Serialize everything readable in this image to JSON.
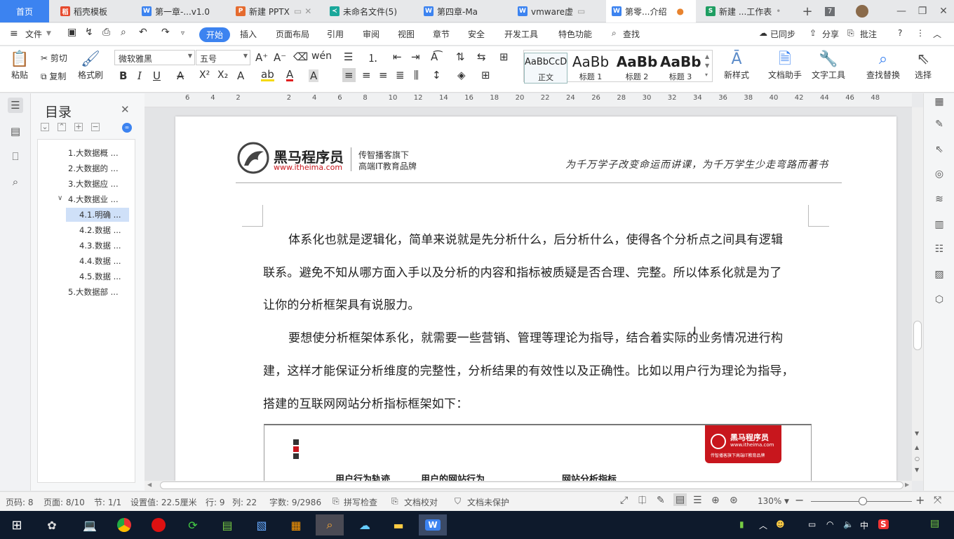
{
  "tabs": [
    {
      "label": "首页"
    },
    {
      "label": "稻壳模板",
      "icon": "docer-icon",
      "color": "#e64a2e"
    },
    {
      "label": "第一章-...v1.0",
      "icon": "word-doc-icon",
      "color": "#3c83f0"
    },
    {
      "label": "新建 PPTX",
      "icon": "ppt-icon",
      "color": "#e56b2f"
    },
    {
      "label": "未命名文件(5)",
      "icon": "flowchart-icon",
      "color": "#19a79a"
    },
    {
      "label": "第四章-Ma",
      "icon": "word-doc-icon",
      "color": "#3c83f0"
    },
    {
      "label": "vmware虚",
      "icon": "word-doc-icon",
      "color": "#3c83f0"
    },
    {
      "label": "第零...介绍",
      "icon": "word-doc-icon",
      "color": "#3c83f0"
    },
    {
      "label": "新建 ...工作表",
      "icon": "sheet-icon",
      "color": "#1e9e62"
    }
  ],
  "tab_count": "7",
  "menu": {
    "file": "文件",
    "items": [
      "开始",
      "插入",
      "页面布局",
      "引用",
      "审阅",
      "视图",
      "章节",
      "安全",
      "开发工具",
      "特色功能"
    ],
    "search": "查找",
    "sync": "已同步",
    "share": "分享",
    "comment": "批注"
  },
  "ribbon": {
    "paste": "粘贴",
    "cut": "剪切",
    "copy": "复制",
    "format_painter": "格式刷",
    "font": "微软雅黑",
    "size": "五号",
    "styles": [
      {
        "preview": "AaBbCcD",
        "label": "正文"
      },
      {
        "preview": "AaBb",
        "label": "标题 1"
      },
      {
        "preview": "AaBb",
        "label": "标题 2"
      },
      {
        "preview": "AaBb",
        "label": "标题 3"
      }
    ],
    "new_style": "新样式",
    "doc_assistant": "文档助手",
    "text_tools": "文字工具",
    "find_replace": "查找替换",
    "select": "选择"
  },
  "toc": {
    "title": "目录",
    "items": [
      {
        "label": "1.大数据概 ...",
        "level": 1
      },
      {
        "label": "2.大数据的 ...",
        "level": 1
      },
      {
        "label": "3.大数据应 ...",
        "level": 1
      },
      {
        "label": "4.大数据业 ...",
        "level": 1
      },
      {
        "label": "4.1.明确 ...",
        "level": 2
      },
      {
        "label": "4.2.数据 ...",
        "level": 2
      },
      {
        "label": "4.3.数据 ...",
        "level": 2
      },
      {
        "label": "4.4.数据 ...",
        "level": 2
      },
      {
        "label": "4.5.数据 ...",
        "level": 2
      },
      {
        "label": "5.大数据部 ...",
        "level": 1
      }
    ]
  },
  "ruler_ticks": [
    "6",
    "4",
    "2",
    "",
    "2",
    "4",
    "6",
    "8",
    "10",
    "12",
    "14",
    "16",
    "18",
    "20",
    "22",
    "24",
    "26",
    "28",
    "30",
    "32",
    "34",
    "36",
    "38",
    "40",
    "42",
    "44",
    "46",
    "48"
  ],
  "header": {
    "brand": "黑马程序员",
    "url": "www.itheima.com",
    "tag1": "传智播客旗下",
    "tag2": "高端IT教育品牌",
    "slogan": "为千万学子改变命运而讲课，为千万学生少走弯路而著书"
  },
  "paragraphs": [
    "体系化也就是逻辑化，简单来说就是先分析什么，后分析什么，使得各个分析点之间具有逻辑",
    "联系。避免不知从哪方面入手以及分析的内容和指标被质疑是否合理、完整。所以体系化就是为了",
    "让你的分析框架具有说服力。",
    "要想使分析框架体系化，就需要一些营销、管理等理论为指导，结合着实际的业务情况进行构",
    "建，这样才能保证分析维度的完整性，分析结果的有效性以及正确性。比如以用户行为理论为指导，",
    "搭建的互联网网站分析指标框架如下："
  ],
  "figure": {
    "labels": [
      "用户行为轨迹",
      "用户的网站行为",
      "网站分析指标"
    ],
    "logo_brand": "黑马程序员",
    "logo_url": "www.itheima.com",
    "logo_tag": "传智播客旗下高端IT教育品牌"
  },
  "status": {
    "page_code": "页码: 8",
    "page": "页面: 8/10",
    "section": "节: 1/1",
    "setting": "设置值: 22.5厘米",
    "row": "行: 9",
    "col": "列: 22",
    "words": "字数: 9/2986",
    "spell": "拼写检查",
    "proof": "文档校对",
    "protect": "文档未保护",
    "zoom": "130%"
  },
  "taskbar": {
    "ime": "中"
  }
}
